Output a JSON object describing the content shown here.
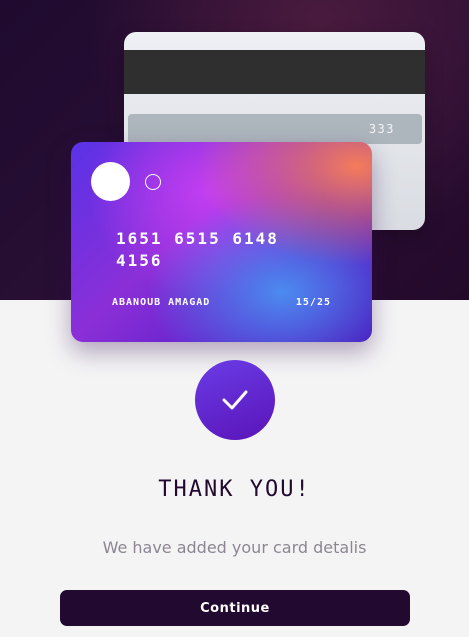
{
  "card_back": {
    "cvc": "333"
  },
  "card_front": {
    "number": "1651 6515 6148 4156",
    "holder_name": "ABANOUB AMAGAD",
    "expiry": "15/25"
  },
  "success": {
    "icon": "checkmark-icon",
    "title": "THANK YOU!",
    "message": "We have added your card detalis"
  },
  "actions": {
    "continue_label": "Continue"
  },
  "colors": {
    "dark": "#21092f",
    "accent": "#6a3ce6",
    "muted_text": "#8e8593",
    "background": "#f4f4f5"
  }
}
